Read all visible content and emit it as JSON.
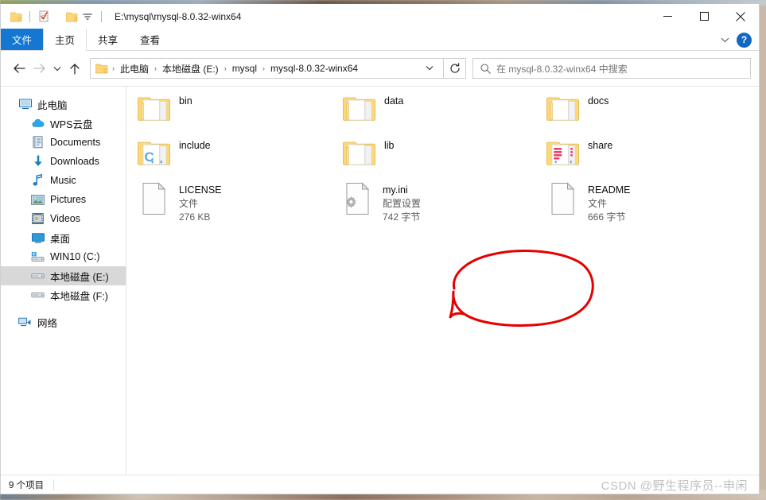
{
  "window": {
    "title_path": "E:\\mysql\\mysql-8.0.32-winx64",
    "quick_access": [
      {
        "name": "folder-icon",
        "label": "文件夹"
      },
      {
        "name": "properties-icon",
        "label": "属性"
      },
      {
        "name": "new-folder-icon",
        "label": "新建文件夹"
      },
      {
        "name": "customize-dropdown-icon",
        "label": "自定义快速访问工具栏"
      }
    ],
    "controls": {
      "minimize": "—",
      "maximize": "☐",
      "close": "✕",
      "ribbon_chevron": "⌄",
      "help": "?"
    }
  },
  "ribbon": {
    "tabs": [
      {
        "label": "文件",
        "style": "file"
      },
      {
        "label": "主页",
        "style": "active"
      },
      {
        "label": "共享",
        "style": "normal"
      },
      {
        "label": "查看",
        "style": "normal"
      }
    ]
  },
  "addressbar": {
    "back": "←",
    "forward": "→",
    "recent": "⌄",
    "up": "↑",
    "breadcrumbs": [
      "此电脑",
      "本地磁盘 (E:)",
      "mysql",
      "mysql-8.0.32-winx64"
    ],
    "breadcrumb_separator": "›",
    "dropdown": "⌄",
    "refresh": "↻"
  },
  "search": {
    "icon": "search-icon",
    "placeholder": "在 mysql-8.0.32-winx64 中搜索"
  },
  "sidebar": {
    "items": [
      {
        "label": "此电脑",
        "icon": "computer-icon",
        "level": 0,
        "selected": false
      },
      {
        "label": "WPS云盘",
        "icon": "cloud-icon",
        "level": 1,
        "selected": false
      },
      {
        "label": "Documents",
        "icon": "documents-icon",
        "level": 1,
        "selected": false
      },
      {
        "label": "Downloads",
        "icon": "downloads-icon",
        "level": 1,
        "selected": false
      },
      {
        "label": "Music",
        "icon": "music-icon",
        "level": 1,
        "selected": false
      },
      {
        "label": "Pictures",
        "icon": "pictures-icon",
        "level": 1,
        "selected": false
      },
      {
        "label": "Videos",
        "icon": "videos-icon",
        "level": 1,
        "selected": false
      },
      {
        "label": "桌面",
        "icon": "desktop-icon",
        "level": 1,
        "selected": false
      },
      {
        "label": "WIN10 (C:)",
        "icon": "system-drive-icon",
        "level": 1,
        "selected": false
      },
      {
        "label": "本地磁盘 (E:)",
        "icon": "drive-icon",
        "level": 1,
        "selected": true
      },
      {
        "label": "本地磁盘 (F:)",
        "icon": "drive-icon",
        "level": 1,
        "selected": false
      },
      {
        "label": "网络",
        "icon": "network-icon",
        "level": 0,
        "selected": false
      }
    ]
  },
  "files": [
    {
      "name": "bin",
      "type": "folder",
      "icon": "folder-plain-icon",
      "col": 0,
      "row": 0,
      "kind": "",
      "size": ""
    },
    {
      "name": "data",
      "type": "folder",
      "icon": "folder-plain-icon",
      "col": 1,
      "row": 0,
      "kind": "",
      "size": ""
    },
    {
      "name": "docs",
      "type": "folder",
      "icon": "folder-plain-icon",
      "col": 2,
      "row": 0,
      "kind": "",
      "size": ""
    },
    {
      "name": "include",
      "type": "folder",
      "icon": "folder-code-icon",
      "col": 0,
      "row": 1,
      "kind": "",
      "size": ""
    },
    {
      "name": "lib",
      "type": "folder",
      "icon": "folder-plain-icon",
      "col": 1,
      "row": 1,
      "kind": "",
      "size": ""
    },
    {
      "name": "share",
      "type": "folder",
      "icon": "folder-share-icon",
      "col": 2,
      "row": 1,
      "kind": "",
      "size": ""
    },
    {
      "name": "LICENSE",
      "type": "file",
      "icon": "file-blank-icon",
      "col": 0,
      "row": 2,
      "kind": "文件",
      "size": "276 KB"
    },
    {
      "name": "my.ini",
      "type": "file",
      "icon": "file-config-icon",
      "col": 1,
      "row": 2,
      "kind": "配置设置",
      "size": "742 字节"
    },
    {
      "name": "README",
      "type": "file",
      "icon": "file-blank-icon",
      "col": 2,
      "row": 2,
      "kind": "文件",
      "size": "666 字节"
    }
  ],
  "annotation": {
    "shape": "hand-drawn-ellipse",
    "color": "#e60000",
    "target": "my.ini"
  },
  "statusbar": {
    "item_count": "9 个项目"
  },
  "watermark": {
    "text": "CSDN @野生程序员--申闲"
  },
  "colors": {
    "accent": "#1577d1",
    "folder": "#fcd77a",
    "selection": "#d8d8d8",
    "annotation": "#e60000"
  }
}
